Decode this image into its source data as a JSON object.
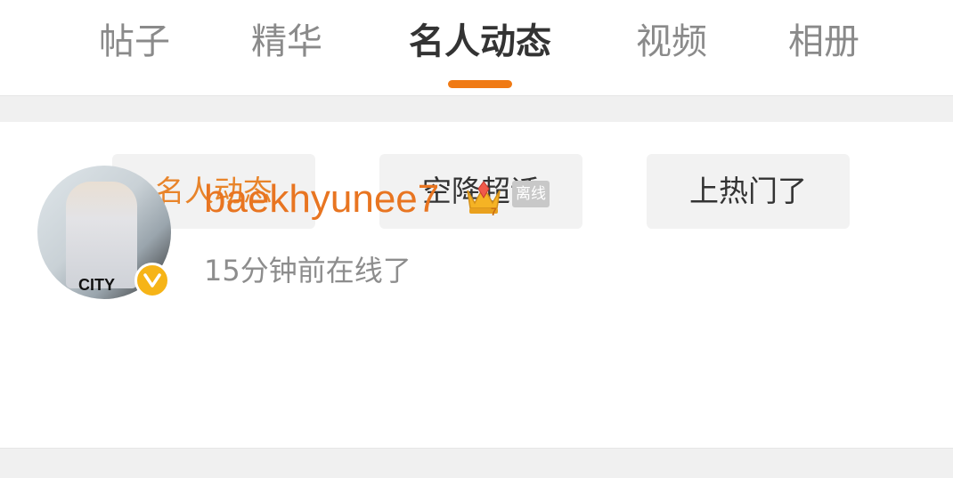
{
  "tabs": [
    {
      "label": "帖子"
    },
    {
      "label": "精华"
    },
    {
      "label": "名人动态",
      "active": true
    },
    {
      "label": "视频"
    },
    {
      "label": "相册"
    }
  ],
  "filters": [
    {
      "label": "名人动态",
      "active": true
    },
    {
      "label": "空降超话"
    },
    {
      "label": "上热门了"
    }
  ],
  "user": {
    "name": "baekhyunee7",
    "avatar_text": "CITY",
    "badge": "离线",
    "status": "15分钟前在线了",
    "crown_icon": "crown-icon",
    "verified_icon": "verified-v-icon"
  },
  "colors": {
    "accent": "#f07a14",
    "username": "#e87521",
    "verified": "#f6b417"
  }
}
